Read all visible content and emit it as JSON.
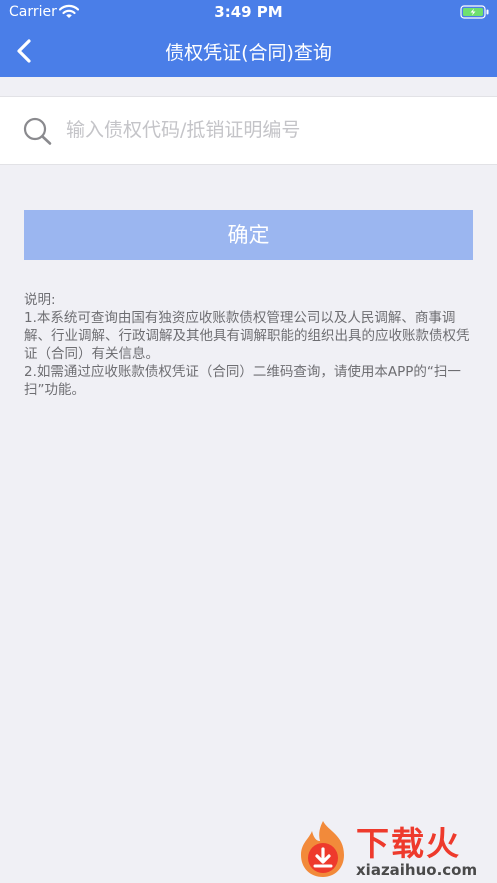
{
  "status_bar": {
    "carrier": "Carrier",
    "time": "3:49 PM"
  },
  "nav": {
    "title": "债权凭证(合同)查询"
  },
  "search": {
    "placeholder": "输入债权代码/抵销证明编号",
    "value": ""
  },
  "confirm_label": "确定",
  "notes": {
    "heading": "说明:",
    "item1": "1.本系统可查询由国有独资应收账款债权管理公司以及人民调解、商事调解、行业调解、行政调解及其他具有调解职能的组织出具的应收账款债权凭证（合同）有关信息。",
    "item2": "2.如需通过应收账款债权凭证（合同）二维码查询，请使用本APP的“扫一扫”功能。"
  },
  "watermark": {
    "title": "下载火",
    "url": "xiazaihuo.com"
  },
  "colors": {
    "nav_background": "#4a7ee8",
    "confirm_background": "#9bb6f0",
    "page_background": "#f0f0f5",
    "watermark_red": "#ee3a2c"
  },
  "icons": [
    "wifi-icon",
    "battery-icon",
    "back-icon",
    "search-icon",
    "flame-logo-icon"
  ]
}
